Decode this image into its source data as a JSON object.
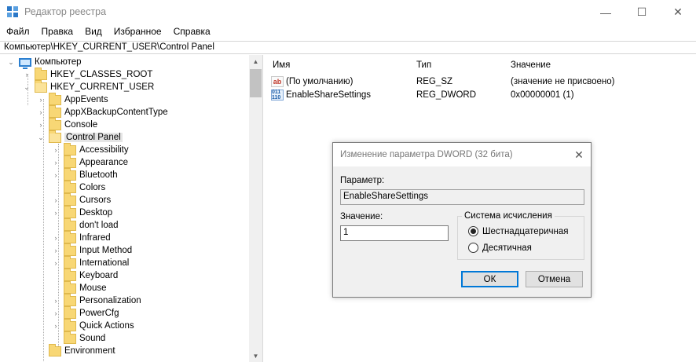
{
  "window": {
    "title": "Редактор реестра",
    "minimize": "—",
    "maximize": "☐",
    "close": "✕"
  },
  "menu": [
    "Файл",
    "Правка",
    "Вид",
    "Избранное",
    "Справка"
  ],
  "address": "Компьютер\\HKEY_CURRENT_USER\\Control Panel",
  "tree": {
    "root": "Компьютер",
    "hives": [
      "HKEY_CLASSES_ROOT",
      "HKEY_CURRENT_USER"
    ],
    "hkcu_children_top": [
      "AppEvents",
      "AppXBackupContentType",
      "Console"
    ],
    "selected": "Control Panel",
    "control_panel_children": [
      {
        "label": "Accessibility",
        "expandable": true
      },
      {
        "label": "Appearance",
        "expandable": true
      },
      {
        "label": "Bluetooth",
        "expandable": true
      },
      {
        "label": "Colors",
        "expandable": false
      },
      {
        "label": "Cursors",
        "expandable": true
      },
      {
        "label": "Desktop",
        "expandable": true
      },
      {
        "label": "don't load",
        "expandable": false
      },
      {
        "label": "Infrared",
        "expandable": true
      },
      {
        "label": "Input Method",
        "expandable": true
      },
      {
        "label": "International",
        "expandable": true
      },
      {
        "label": "Keyboard",
        "expandable": false
      },
      {
        "label": "Mouse",
        "expandable": false
      },
      {
        "label": "Personalization",
        "expandable": true
      },
      {
        "label": "PowerCfg",
        "expandable": true
      },
      {
        "label": "Quick Actions",
        "expandable": true
      },
      {
        "label": "Sound",
        "expandable": false
      }
    ],
    "after": "Environment"
  },
  "list": {
    "columns": [
      "Имя",
      "Тип",
      "Значение"
    ],
    "rows": [
      {
        "icon": "string-value-icon",
        "icon_text": "ab",
        "name": "(По умолчанию)",
        "type": "REG_SZ",
        "value": "(значение не присвоено)"
      },
      {
        "icon": "binary-value-icon",
        "icon_text": "011 110",
        "name": "EnableShareSettings",
        "type": "REG_DWORD",
        "value": "0x00000001 (1)"
      }
    ]
  },
  "dialog": {
    "title": "Изменение параметра DWORD (32 бита)",
    "close": "✕",
    "param_label": "Параметр:",
    "param_value": "EnableShareSettings",
    "value_label": "Значение:",
    "value": "1",
    "base_group": "Система исчисления",
    "radio_hex": "Шестнадцатеричная",
    "radio_dec": "Десятичная",
    "selected_base": "hex",
    "ok": "ОК",
    "cancel": "Отмена"
  },
  "colors": {
    "accent": "#0078d7",
    "folder": "#f8d775",
    "selection": "#e5e5e5"
  }
}
